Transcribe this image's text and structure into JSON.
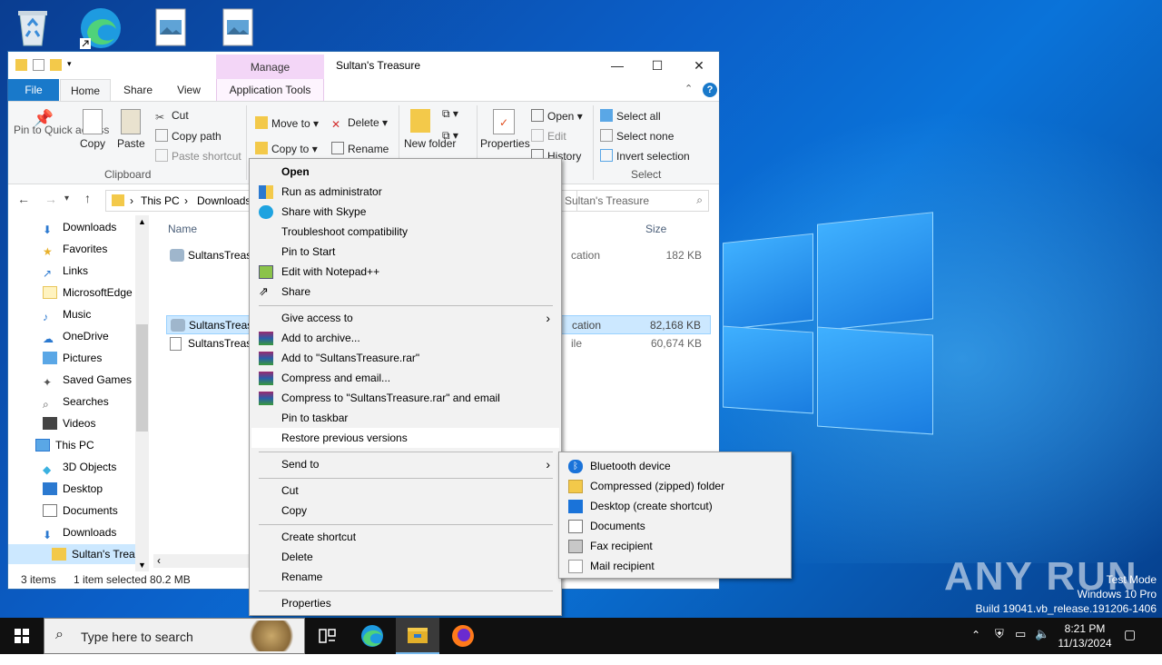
{
  "window": {
    "title": "Sultan's Treasure",
    "manage_tab": "Manage",
    "minimize": "—",
    "maximize": "☐",
    "close": "✕"
  },
  "tabs": [
    "File",
    "Home",
    "Share",
    "View",
    "Application Tools"
  ],
  "ribbon": {
    "pin_quick_access": "Pin to Quick access",
    "copy": "Copy",
    "paste": "Paste",
    "cut": "Cut",
    "copy_path": "Copy path",
    "paste_shortcut": "Paste shortcut",
    "clipboard_label": "Clipboard",
    "move_to": "Move to",
    "copy_to": "Copy to",
    "delete": "Delete",
    "rename": "Rename",
    "new_folder": "New folder",
    "properties": "Properties",
    "open": "Open",
    "edit": "Edit",
    "history": "History",
    "select_all": "Select all",
    "select_none": "Select none",
    "invert_selection": "Invert selection",
    "select_label": "Select"
  },
  "address": {
    "crumbs": [
      "This PC",
      "Downloads"
    ],
    "search_placeholder": "Sultan's Treasure"
  },
  "nav": {
    "items": [
      "Downloads",
      "Favorites",
      "Links",
      "MicrosoftEdge",
      "Music",
      "OneDrive",
      "Pictures",
      "Saved Games",
      "Searches",
      "Videos",
      "This PC",
      "3D Objects",
      "Desktop",
      "Documents",
      "Downloads",
      "Sultan's Treas"
    ]
  },
  "filelist": {
    "col_name": "Name",
    "col_size": "Size",
    "rows": [
      {
        "name": "SultansTreasu",
        "type": "cation",
        "size": "182 KB"
      },
      {
        "name": "SultansTreasu",
        "type": "cation",
        "size": "82,168 KB"
      },
      {
        "name": "SultansTreasu",
        "type": "ile",
        "size": "60,674 KB"
      }
    ]
  },
  "status": {
    "items": "3 items",
    "selected": "1 item selected  80.2 MB"
  },
  "context_menu": {
    "items": [
      "Open",
      "Run as administrator",
      "Share with Skype",
      "Troubleshoot compatibility",
      "Pin to Start",
      "Edit with Notepad++",
      "Share",
      "Give access to",
      "Add to archive...",
      "Add to \"SultansTreasure.rar\"",
      "Compress and email...",
      "Compress to \"SultansTreasure.rar\" and email",
      "Pin to taskbar",
      "Restore previous versions",
      "Send to",
      "Cut",
      "Copy",
      "Create shortcut",
      "Delete",
      "Rename",
      "Properties"
    ]
  },
  "send_to": {
    "items": [
      "Bluetooth device",
      "Compressed (zipped) folder",
      "Desktop (create shortcut)",
      "Documents",
      "Fax recipient",
      "Mail recipient"
    ]
  },
  "taskbar": {
    "search_placeholder": "Type here to search",
    "time": "8:21 PM",
    "date": "11/13/2024"
  },
  "watermark": {
    "brand": "ANY RUN",
    "line1": "Test Mode",
    "line2": "Windows 10 Pro",
    "line3": "Build 19041.vb_release.191206-1406"
  },
  "colors": {
    "accent": "#1979ca",
    "selection": "#cce8ff",
    "desktop": "#0b5fc8"
  }
}
